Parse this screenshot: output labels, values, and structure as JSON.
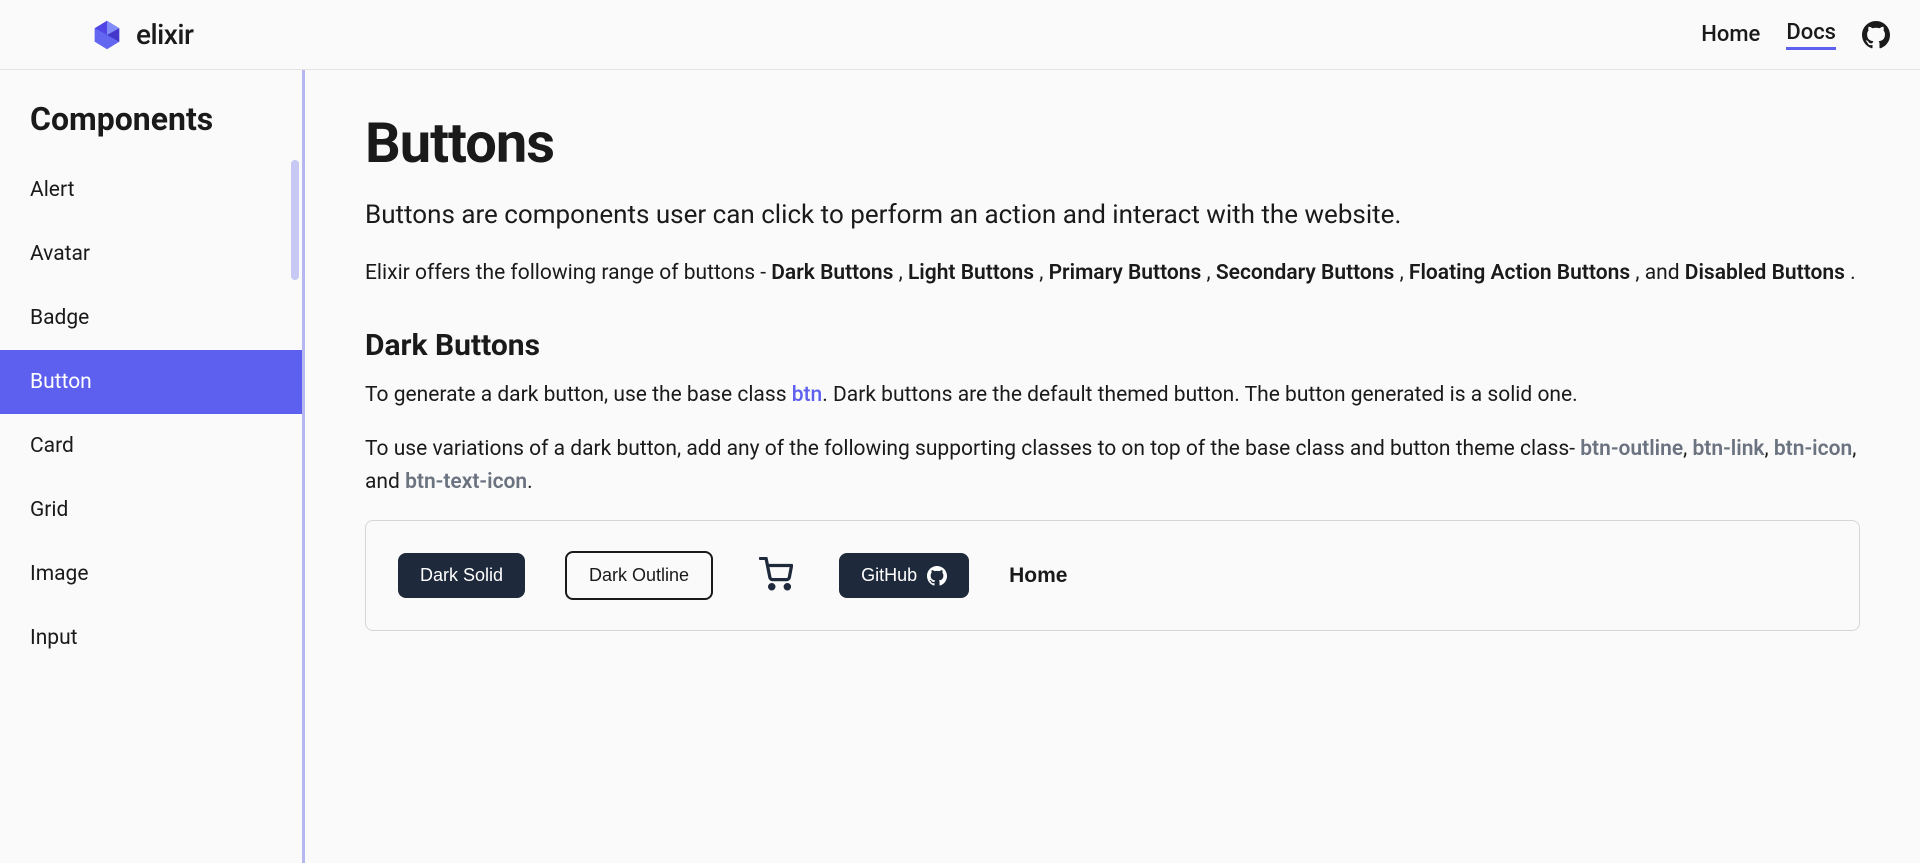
{
  "header": {
    "brand": "elixir",
    "nav": {
      "home": "Home",
      "docs": "Docs"
    }
  },
  "sidebar": {
    "title": "Components",
    "items": [
      "Alert",
      "Avatar",
      "Badge",
      "Button",
      "Card",
      "Grid",
      "Image",
      "Input"
    ],
    "active_index": 3
  },
  "page": {
    "title": "Buttons",
    "intro": "Buttons are components user can click to perform an action and interact with the website.",
    "types_lead": "Elixir offers the following range of buttons - ",
    "types": [
      "Dark Buttons",
      "Light Buttons",
      "Primary Buttons",
      "Secondary Buttons",
      "Floating Action Buttons",
      "Disabled Buttons"
    ],
    "types_and": "and"
  },
  "dark_section": {
    "title": "Dark Buttons",
    "p1a": "To generate a dark button, use the base class ",
    "p1_class": "btn",
    "p1b": ". Dark buttons are the default themed button. The button generated is a solid one.",
    "p2a": "To use variations of a dark button, add any of the following supporting classes to on top of the base class and button theme class- ",
    "var_classes": [
      "btn-outline",
      "btn-link",
      "btn-icon",
      "btn-text-icon"
    ],
    "demo": {
      "solid": "Dark Solid",
      "outline": "Dark Outline",
      "text_icon": "GitHub",
      "link": "Home"
    }
  }
}
